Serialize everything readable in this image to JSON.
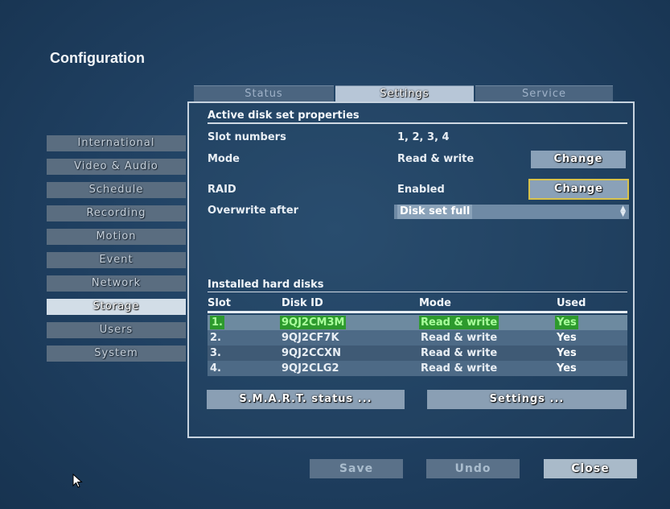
{
  "window": {
    "title": "Configuration"
  },
  "tabs": [
    {
      "label": "Status",
      "active": false
    },
    {
      "label": "Settings",
      "active": true
    },
    {
      "label": "Service",
      "active": false
    }
  ],
  "sidebar": {
    "items": [
      {
        "label": "International"
      },
      {
        "label": "Video & Audio"
      },
      {
        "label": "Schedule"
      },
      {
        "label": "Recording"
      },
      {
        "label": "Motion"
      },
      {
        "label": "Event"
      },
      {
        "label": "Network"
      },
      {
        "label": "Storage",
        "active": true
      },
      {
        "label": "Users"
      },
      {
        "label": "System"
      }
    ]
  },
  "props": {
    "section_title": "Active disk set properties",
    "slot_numbers_label": "Slot numbers",
    "slot_numbers_value": "1, 2, 3, 4",
    "mode_label": "Mode",
    "mode_value": "Read & write",
    "mode_change": "Change",
    "raid_label": "RAID",
    "raid_value": "Enabled",
    "raid_change": "Change",
    "overwrite_label": "Overwrite after",
    "overwrite_value": "Disk set full"
  },
  "disks": {
    "section_title": "Installed hard disks",
    "headers": [
      "Slot",
      "Disk ID",
      "Mode",
      "Used"
    ],
    "rows": [
      {
        "slot": "1.",
        "id": "9QJ2CM3M",
        "mode": "Read & write",
        "used": "Yes"
      },
      {
        "slot": "2.",
        "id": "9QJ2CF7K",
        "mode": "Read & write",
        "used": "Yes"
      },
      {
        "slot": "3.",
        "id": "9QJ2CCXN",
        "mode": "Read & write",
        "used": "Yes"
      },
      {
        "slot": "4.",
        "id": "9QJ2CLG2",
        "mode": "Read & write",
        "used": "Yes"
      }
    ],
    "smart_button": "S.M.A.R.T. status ...",
    "settings_button": "Settings ..."
  },
  "footer": {
    "save": "Save",
    "undo": "Undo",
    "close": "Close"
  },
  "icons": {
    "cursor": "mouse-pointer-icon",
    "dropdown": "updown-arrow-icon"
  },
  "colors": {
    "background": "#1f3f60",
    "focus_border": "#d8c24a",
    "highlight": "#2d9a2d"
  }
}
